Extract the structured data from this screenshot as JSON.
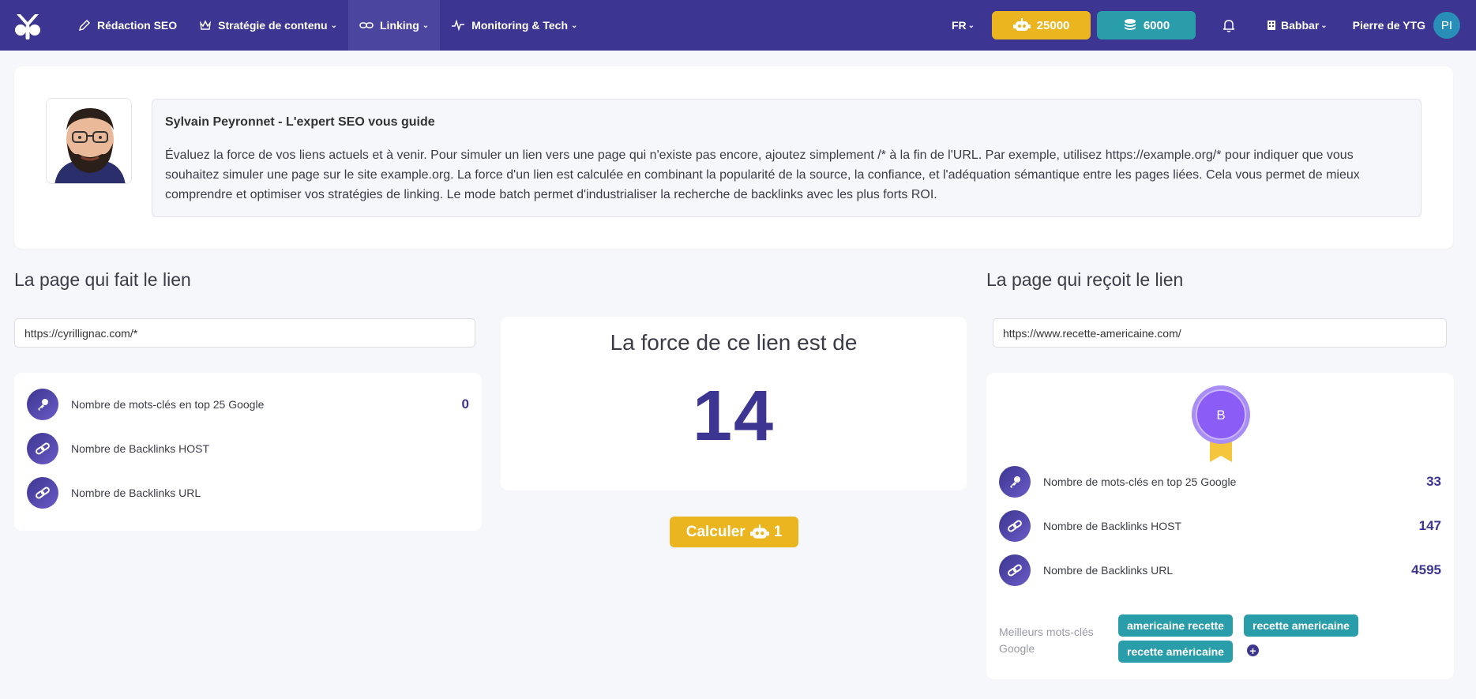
{
  "nav": {
    "items": [
      {
        "label": "Rédaction SEO",
        "has_menu": false
      },
      {
        "label": "Stratégie de contenu",
        "has_menu": true
      },
      {
        "label": "Linking",
        "has_menu": true,
        "active": true
      },
      {
        "label": "Monitoring & Tech",
        "has_menu": true
      }
    ],
    "lang": "FR",
    "credits_robot": "25000",
    "credits_coins": "6000",
    "org": "Babbar",
    "user": "Pierre de YTG",
    "avatar_initials": "PI"
  },
  "guide": {
    "title": "Sylvain Peyronnet - L'expert SEO vous guide",
    "text": "Évaluez la force de vos liens actuels et à venir. Pour simuler un lien vers une page qui n'existe pas encore, ajoutez simplement /* à la fin de l'URL. Par exemple, utilisez https://example.org/* pour indiquer que vous souhaitez simuler une page sur le site example.org. La force d'un lien est calculée en combinant la popularité de la source, la confiance, et l'adéquation sémantique entre les pages liées. Cela vous permet de mieux comprendre et optimiser vos stratégies de linking. Le mode batch permet d'industrialiser la recherche de backlinks avec les plus forts ROI."
  },
  "source": {
    "title": "La page qui fait le lien",
    "url": "https://cyrillignac.com/*",
    "stats": [
      {
        "label": "Nombre de mots-clés en top 25 Google",
        "value": "0",
        "icon": "key-icon"
      },
      {
        "label": "Nombre de Backlinks HOST",
        "value": "",
        "icon": "link-icon"
      },
      {
        "label": "Nombre de Backlinks URL",
        "value": "",
        "icon": "link-icon"
      }
    ]
  },
  "force": {
    "title": "La force de ce lien est de",
    "value": "14",
    "button_label": "Calculer",
    "button_cost": "1"
  },
  "target": {
    "title": "La page qui reçoit le lien",
    "url": "https://www.recette-americaine.com/",
    "badge_grade": "B",
    "stats": [
      {
        "label": "Nombre de mots-clés en top 25 Google",
        "value": "33",
        "icon": "key-icon"
      },
      {
        "label": "Nombre de Backlinks HOST",
        "value": "147",
        "icon": "link-icon"
      },
      {
        "label": "Nombre de Backlinks URL",
        "value": "4595",
        "icon": "link-icon"
      }
    ],
    "keywords_label": "Meilleurs mots-clés Google",
    "keywords": [
      "americaine recette",
      "recette americaine",
      "recette américaine"
    ],
    "add_symbol": "+"
  },
  "colors": {
    "nav_bg": "#3c3591",
    "accent": "#3c3591",
    "yellow": "#eab51f",
    "teal": "#2a9dab",
    "badge": "#8b5cf6"
  }
}
